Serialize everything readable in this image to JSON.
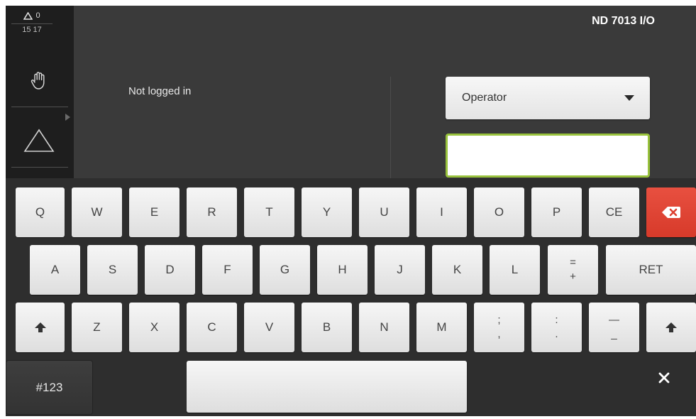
{
  "status": {
    "warning_count": "0",
    "time": "15 17"
  },
  "header": {
    "device_title": "ND 7013 I/O"
  },
  "login": {
    "status_text": "Not logged in",
    "user_dropdown": {
      "selected": "Operator"
    },
    "password": {
      "value": "",
      "placeholder": ""
    }
  },
  "keyboard": {
    "row1": [
      "Q",
      "W",
      "E",
      "R",
      "T",
      "Y",
      "U",
      "I",
      "O",
      "P",
      "CE"
    ],
    "row2": [
      "A",
      "S",
      "D",
      "F",
      "G",
      "H",
      "J",
      "K",
      "L"
    ],
    "row2_dual": {
      "top": "=",
      "bottom": "+"
    },
    "return_label": "RET",
    "row3": [
      "Z",
      "X",
      "C",
      "V",
      "B",
      "N",
      "M"
    ],
    "row3_dual": [
      {
        "top": ";",
        "bottom": ","
      },
      {
        "top": ":",
        "bottom": "."
      },
      {
        "top": "—",
        "bottom": "_"
      }
    ],
    "symbols_label": "#123"
  },
  "icons": {
    "warning": "warning-triangle-icon",
    "manual_mode": "hand-icon",
    "mode_indicator": "triangle-outline-icon",
    "backspace": "backspace-icon",
    "shift": "shift-arrow-icon",
    "close": "close-icon"
  },
  "colors": {
    "accent_focus": "#98c23c",
    "backspace_red": "#dd4030",
    "background": "#3a3a3a",
    "sidebar": "#1e1e1e"
  }
}
